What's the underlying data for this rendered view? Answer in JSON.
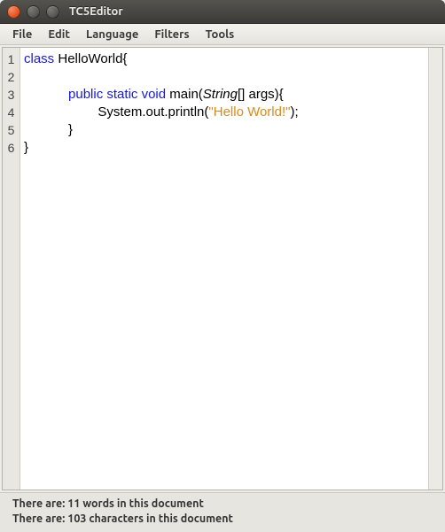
{
  "window": {
    "title": "TC5Editor"
  },
  "menubar": {
    "items": [
      "File",
      "Edit",
      "Language",
      "Filters",
      "Tools"
    ]
  },
  "editor": {
    "line_numbers": [
      "1",
      "2",
      "3",
      "4",
      "5",
      "6"
    ],
    "lines": [
      {
        "indent": "",
        "tokens": [
          {
            "cls": "kw",
            "text": "class"
          },
          {
            "cls": "",
            "text": " HelloWorld{"
          }
        ]
      },
      {
        "indent": "",
        "tokens": []
      },
      {
        "indent": "            ",
        "tokens": [
          {
            "cls": "kw",
            "text": "public"
          },
          {
            "cls": "",
            "text": " "
          },
          {
            "cls": "kw",
            "text": "static"
          },
          {
            "cls": "",
            "text": " "
          },
          {
            "cls": "kw",
            "text": "void"
          },
          {
            "cls": "",
            "text": " main("
          },
          {
            "cls": "type",
            "text": "String"
          },
          {
            "cls": "",
            "text": "[] args){"
          }
        ]
      },
      {
        "indent": "                    ",
        "tokens": [
          {
            "cls": "",
            "text": "System.out.println("
          },
          {
            "cls": "str",
            "text": "\"Hello World!\""
          },
          {
            "cls": "",
            "text": ");"
          }
        ]
      },
      {
        "indent": "            ",
        "tokens": [
          {
            "cls": "",
            "text": "}"
          }
        ]
      },
      {
        "indent": "",
        "tokens": [
          {
            "cls": "",
            "text": "}"
          }
        ]
      }
    ]
  },
  "statusbar": {
    "line1": "There are: 11 words in this document",
    "line2": "There are: 103 characters in this document"
  }
}
